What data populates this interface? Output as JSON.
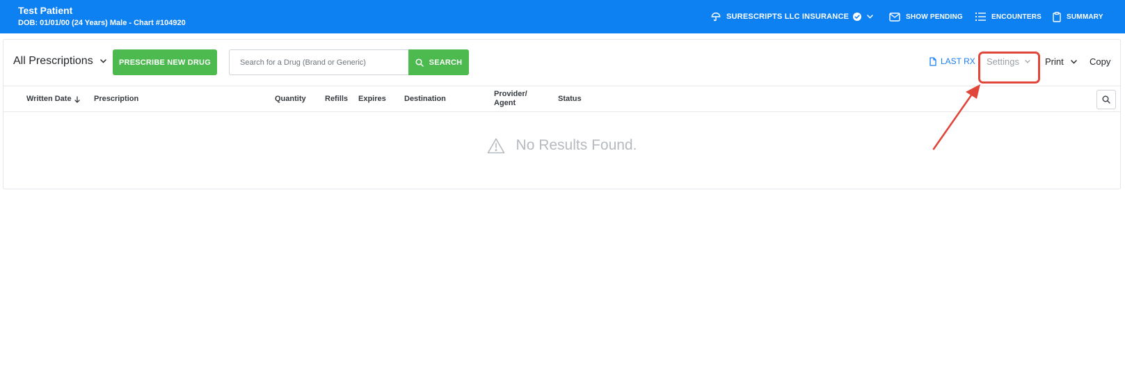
{
  "header": {
    "patient_name": "Test Patient",
    "patient_meta": "DOB: 01/01/00 (24 Years) Male - Chart #104920",
    "insurance_label": "SURESCRIPTS LLC INSURANCE",
    "show_pending_label": "SHOW PENDING",
    "encounters_label": "ENCOUNTERS",
    "summary_label": "SUMMARY",
    "bg_color": "#0d80f2"
  },
  "toolbar": {
    "filter_label": "All Prescriptions",
    "prescribe_label": "PRESCRIBE NEW DRUG",
    "search_placeholder": "Search for a Drug (Brand or Generic)",
    "search_value": "",
    "search_button_label": "SEARCH",
    "last_rx_label": "LAST RX",
    "settings_label": "Settings",
    "print_label": "Print",
    "copy_label": "Copy",
    "accent_green": "#4cba4f",
    "link_blue": "#1a7ef0"
  },
  "table": {
    "columns": {
      "written_date": "Written Date",
      "prescription": "Prescription",
      "quantity": "Quantity",
      "refills": "Refills",
      "expires": "Expires",
      "destination": "Destination",
      "provider_agent": "Provider/ Agent",
      "status": "Status"
    },
    "sort_column": "Written Date",
    "sort_direction": "descending",
    "rows": [],
    "empty_message": "No Results Found."
  },
  "annotation": {
    "highlight_target": "Settings",
    "highlight_color": "#e0473a"
  }
}
